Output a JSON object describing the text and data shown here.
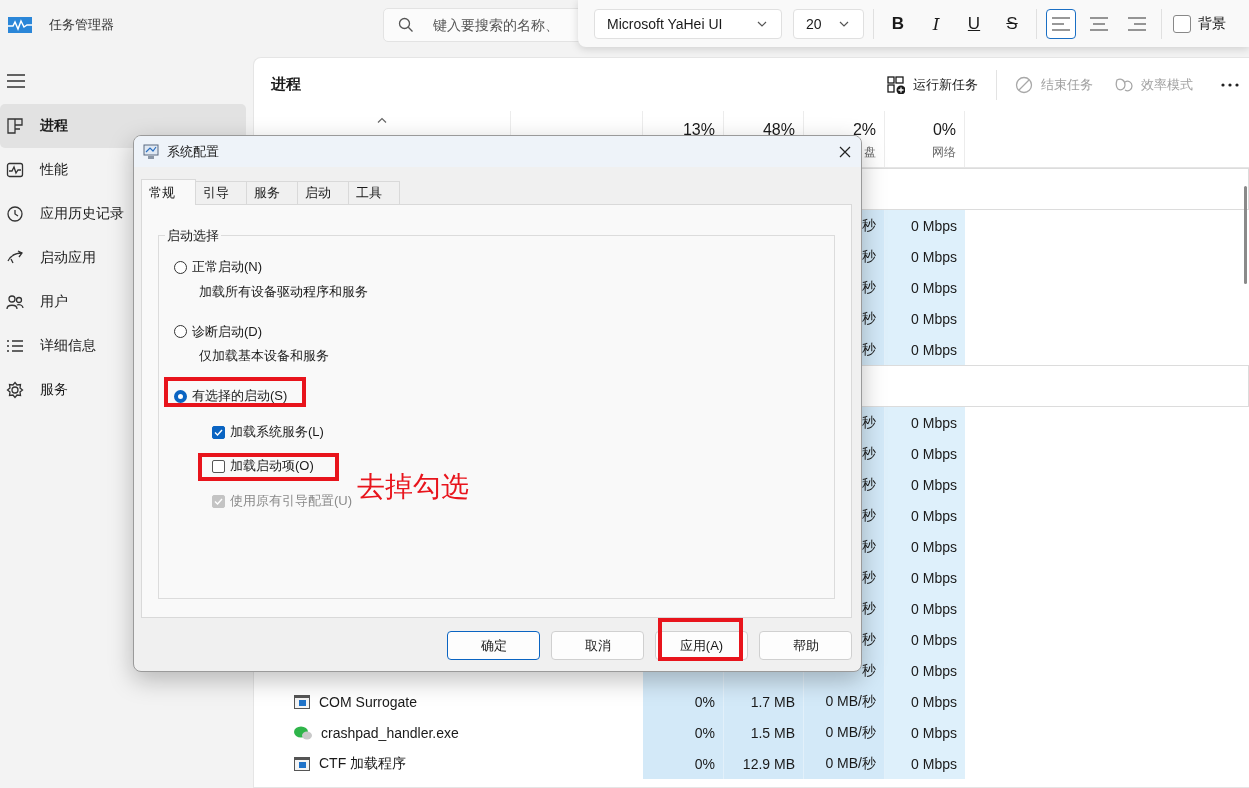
{
  "title_bar": {
    "title": "任务管理器",
    "search": {
      "placeholder": "键入要搜索的名称、"
    }
  },
  "format_toolbar": {
    "font": "Microsoft YaHei UI",
    "size": "20",
    "styles": [
      {
        "label": "B",
        "kind": "bold"
      },
      {
        "label": "I",
        "kind": "italic"
      },
      {
        "label": "U",
        "kind": "underline"
      },
      {
        "label": "S",
        "kind": "strike"
      }
    ],
    "alignments": [
      {
        "kind": "left",
        "selected": true
      },
      {
        "kind": "center",
        "selected": false
      },
      {
        "kind": "right",
        "selected": false
      }
    ],
    "background": {
      "label": "背景",
      "checked": false
    }
  },
  "sidebar": {
    "items": [
      {
        "label": "进程",
        "kind": "processes",
        "selected": true
      },
      {
        "label": "性能",
        "kind": "performance",
        "selected": false
      },
      {
        "label": "应用历史记录",
        "kind": "history",
        "selected": false
      },
      {
        "label": "启动应用",
        "kind": "startup",
        "selected": false
      },
      {
        "label": "用户",
        "kind": "users",
        "selected": false
      },
      {
        "label": "详细信息",
        "kind": "details",
        "selected": false
      },
      {
        "label": "服务",
        "kind": "services",
        "selected": false
      }
    ]
  },
  "page": {
    "title": "进程",
    "actions": [
      {
        "label": "运行新任务",
        "kind": "run",
        "disabled": false
      },
      {
        "label": "结束任务",
        "kind": "end",
        "disabled": true
      },
      {
        "label": "效率模式",
        "kind": "eco",
        "disabled": true
      }
    ]
  },
  "table": {
    "columns": [
      {
        "kind": "name",
        "sorted": true
      },
      {
        "kind": "status"
      },
      {
        "kind": "metric",
        "percent": "13%"
      },
      {
        "kind": "metric",
        "percent": "48%"
      },
      {
        "kind": "metric",
        "percent": "2%",
        "label": "盘"
      },
      {
        "kind": "metric",
        "percent": "0%",
        "label": "网络"
      }
    ],
    "rows": [
      {
        "kind": "group"
      },
      {
        "kind": "system",
        "disk": "秒",
        "network": "0 Mbps"
      },
      {
        "kind": "system",
        "disk": "秒",
        "network": "0 Mbps"
      },
      {
        "kind": "system",
        "disk": "秒",
        "network": "0 Mbps"
      },
      {
        "kind": "system",
        "disk": "秒",
        "network": "0 Mbps"
      },
      {
        "kind": "system",
        "disk": "秒",
        "network": "0 Mbps"
      },
      {
        "kind": "group"
      },
      {
        "kind": "system",
        "disk": "秒",
        "network": "0 Mbps"
      },
      {
        "kind": "system",
        "disk": "秒",
        "network": "0 Mbps"
      },
      {
        "kind": "system",
        "disk": "秒",
        "network": "0 Mbps"
      },
      {
        "kind": "system",
        "disk": "秒",
        "network": "0 Mbps"
      },
      {
        "kind": "system",
        "disk": "秒",
        "network": "0 Mbps"
      },
      {
        "kind": "system",
        "disk": "秒",
        "network": "0 Mbps"
      },
      {
        "kind": "system",
        "disk": "秒",
        "network": "0 Mbps"
      },
      {
        "kind": "system",
        "disk": "秒",
        "network": "0 Mbps"
      },
      {
        "kind": "system",
        "disk": "秒",
        "network": "0 Mbps"
      },
      {
        "kind": "system",
        "name": "COM Surrogate",
        "cpu": "0%",
        "memory": "1.7 MB",
        "disk": "0 MB/秒",
        "network": "0 Mbps"
      },
      {
        "kind": "app",
        "name": "crashpad_handler.exe",
        "cpu": "0%",
        "memory": "1.5 MB",
        "disk": "0 MB/秒",
        "network": "0 Mbps"
      },
      {
        "kind": "system",
        "name": "CTF 加载程序",
        "cpu": "0%",
        "memory": "12.9 MB",
        "disk": "0 MB/秒",
        "network": "0 Mbps"
      }
    ]
  },
  "dialog": {
    "title": "系统配置",
    "tabs": [
      {
        "label": "常规",
        "selected": true
      },
      {
        "label": "引导",
        "selected": false
      },
      {
        "label": "服务",
        "selected": false
      },
      {
        "label": "启动",
        "selected": false
      },
      {
        "label": "工具",
        "selected": false
      }
    ],
    "group_title": "启动选择",
    "options": [
      {
        "kind": "radio",
        "label": "正常启动(N)",
        "description": "加载所有设备驱动程序和服务",
        "selected": false,
        "highlighted": false
      },
      {
        "kind": "radio",
        "label": "诊断启动(D)",
        "description": "仅加载基本设备和服务",
        "selected": false,
        "highlighted": false
      },
      {
        "kind": "radio",
        "label": "有选择的启动(S)",
        "selected": true,
        "highlighted": true
      },
      {
        "kind": "checkbox",
        "label": "加载系统服务(L)",
        "checked": true,
        "disabled": false,
        "highlighted": false
      },
      {
        "kind": "checkbox",
        "label": "加载启动项(O)",
        "checked": false,
        "disabled": false,
        "highlighted": true,
        "note": "去掉勾选"
      },
      {
        "kind": "checkbox",
        "label": "使用原有引导配置(U)",
        "checked": true,
        "disabled": true,
        "highlighted": false
      }
    ],
    "buttons": [
      {
        "label": "确定",
        "default": true,
        "highlighted": false
      },
      {
        "label": "取消",
        "default": false,
        "highlighted": false
      },
      {
        "label": "应用(A)",
        "default": false,
        "highlighted": true
      },
      {
        "label": "帮助",
        "default": false,
        "highlighted": false
      }
    ]
  }
}
